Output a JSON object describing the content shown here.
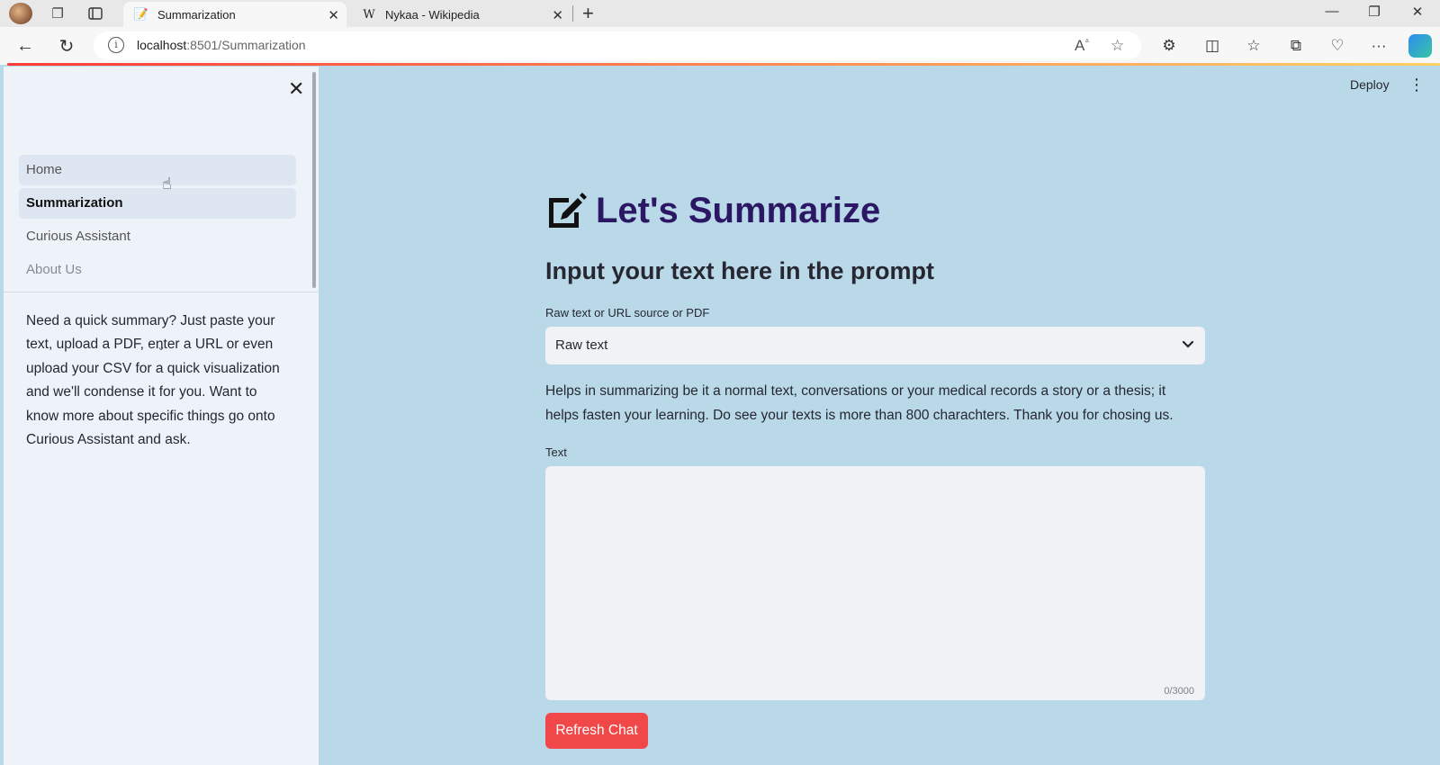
{
  "browser": {
    "tabs": [
      {
        "title": "Summarization",
        "favicon": "notepad-favicon",
        "active": true
      },
      {
        "title": "Nykaa - Wikipedia",
        "favicon": "wikipedia-favicon",
        "favicon_letter": "W",
        "active": false
      }
    ],
    "url_host": "localhost",
    "url_rest": ":8501/Summarization"
  },
  "app": {
    "deploy_label": "Deploy",
    "sidebar": {
      "nav": [
        {
          "label": "Home"
        },
        {
          "label": "Summarization"
        },
        {
          "label": "Curious Assistant"
        },
        {
          "label": "About Us"
        }
      ],
      "description": "Need a quick summary? Just paste your text, upload a PDF, enter a URL or even upload your CSV for a quick visualization and we'll condense it for you. Want to know more about specific things go onto Curious Assistant and ask."
    },
    "main": {
      "title": "Let's Summarize",
      "subtitle": "Input your text here in the prompt",
      "source_label": "Raw text or URL source or PDF",
      "source_value": "Raw text",
      "help_text": "Helps in summarizing be it a normal text, conversations or your medical records a story or a thesis; it helps fasten your learning. Do see your texts is more than 800 charachters. Thank you for chosing us.",
      "text_label": "Text",
      "text_value": "",
      "char_counter": "0/3000",
      "refresh_button": "Refresh Chat"
    }
  },
  "colors": {
    "main_bg": "#b9d9e9",
    "sidebar_bg": "#eef3f9",
    "title": "#2b1764",
    "button": "#f04848"
  }
}
